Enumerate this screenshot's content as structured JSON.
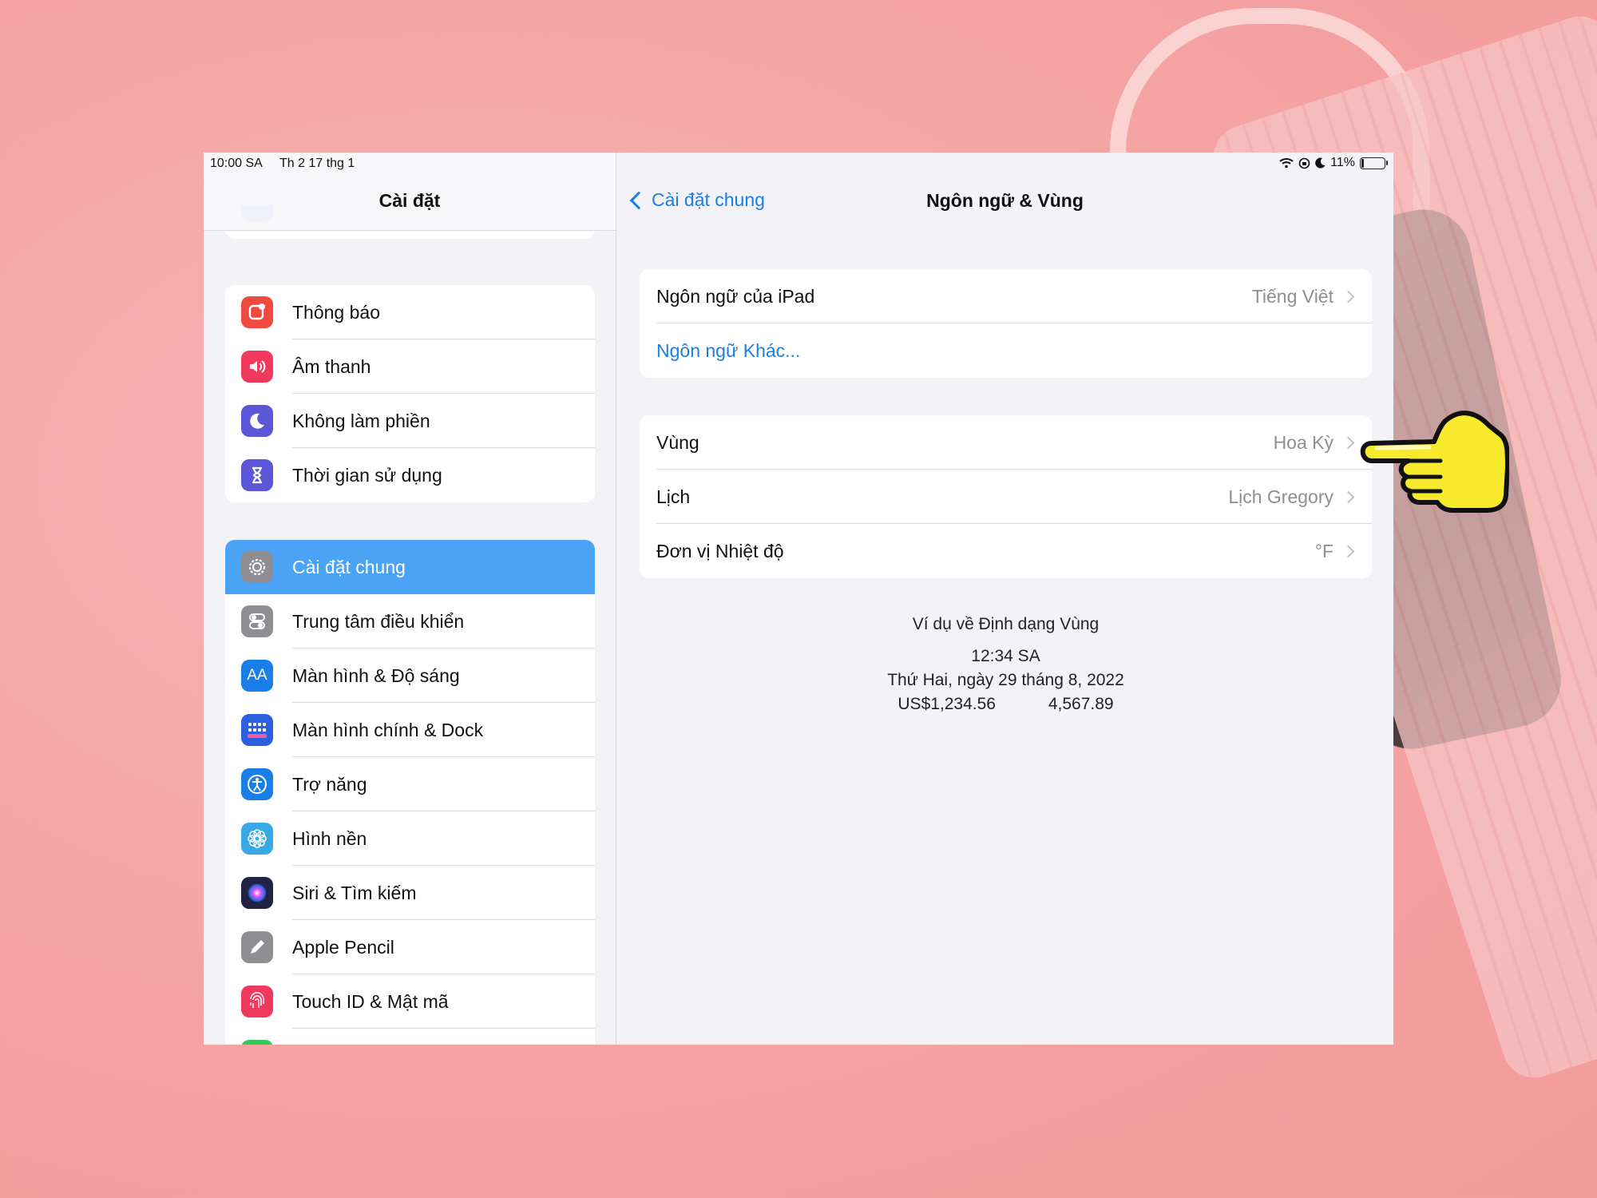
{
  "status_bar": {
    "time": "10:00 SA",
    "date": "Th 2 17 thg 1",
    "battery": "11%"
  },
  "sidebar": {
    "title": "Cài đặt",
    "group1": [
      {
        "label": "Thông báo",
        "icon": "notifications-icon",
        "color": "#f04a3f"
      },
      {
        "label": "Âm thanh",
        "icon": "sound-icon",
        "color": "#f0395c"
      },
      {
        "label": "Không làm phiền",
        "icon": "moon-icon",
        "color": "#5b57d8"
      },
      {
        "label": "Thời gian sử dụng",
        "icon": "hourglass-icon",
        "color": "#5b57d8"
      }
    ],
    "group2": [
      {
        "label": "Cài đặt chung",
        "icon": "gear-icon",
        "color": "#8e8e93"
      },
      {
        "label": "Trung tâm điều khiển",
        "icon": "toggles-icon",
        "color": "#8e8e93"
      },
      {
        "label": "Màn hình & Độ sáng",
        "icon": "text-size-icon",
        "color": "#1a7ee8",
        "glyph": "AA"
      },
      {
        "label": "Màn hình chính & Dock",
        "icon": "grid-icon",
        "color": "#2c5fe0"
      },
      {
        "label": "Trợ năng",
        "icon": "accessibility-icon",
        "color": "#1a7ee8"
      },
      {
        "label": "Hình nền",
        "icon": "flower-icon",
        "color": "#38a9e4"
      },
      {
        "label": "Siri & Tìm kiếm",
        "icon": "siri-icon",
        "color": "#222244"
      },
      {
        "label": "Apple Pencil",
        "icon": "pencil-icon",
        "color": "#8e8e93"
      },
      {
        "label": "Touch ID & Mật mã",
        "icon": "fingerprint-icon",
        "color": "#f0395c"
      }
    ]
  },
  "detail": {
    "back_label": "Cài đặt chung",
    "title": "Ngôn ngữ & Vùng",
    "language_group": {
      "ipad_language_label": "Ngôn ngữ của iPad",
      "ipad_language_value": "Tiếng Việt",
      "other_languages_label": "Ngôn ngữ Khác..."
    },
    "region_group": {
      "region_label": "Vùng",
      "region_value": "Hoa Kỳ",
      "calendar_label": "Lịch",
      "calendar_value": "Lịch Gregory",
      "temperature_label": "Đơn vị Nhiệt độ",
      "temperature_value": "°F"
    },
    "example": {
      "heading": "Ví dụ về Định dạng Vùng",
      "time": "12:34 SA",
      "date": "Thứ Hai, ngày 29 tháng 8, 2022",
      "currency": "US$1,234.56",
      "number": "4,567.89"
    }
  },
  "pointer": {
    "icon": "pointing-hand-icon",
    "color": "#f7ea2c"
  }
}
